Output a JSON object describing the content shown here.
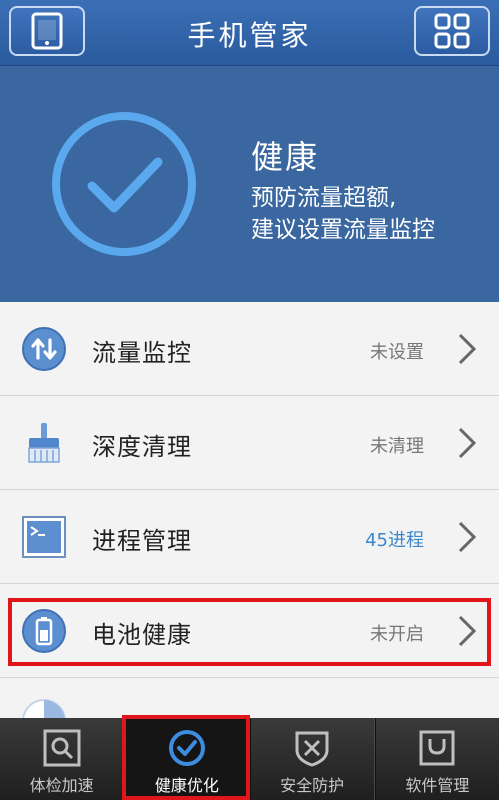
{
  "header": {
    "title": "手机管家"
  },
  "hero": {
    "status_title": "健康",
    "line1": "预防流量超额,",
    "line2": "建议设置流量监控"
  },
  "list": [
    {
      "label": "流量监控",
      "status": "未设置",
      "icon": "traffic-arrows-icon"
    },
    {
      "label": "深度清理",
      "status": "未清理",
      "icon": "brush-icon"
    },
    {
      "label": "进程管理",
      "status": "45进程",
      "icon": "terminal-icon"
    },
    {
      "label": "电池健康",
      "status": "未开启",
      "icon": "battery-icon"
    }
  ],
  "tabs": [
    {
      "label": "体检加速",
      "icon": "magnifier-icon"
    },
    {
      "label": "健康优化",
      "icon": "check-circle-icon"
    },
    {
      "label": "安全防护",
      "icon": "shield-icon"
    },
    {
      "label": "软件管理",
      "icon": "bag-icon"
    }
  ],
  "colors": {
    "header_blue": "#2b5a9e",
    "hero_blue": "#3a679f",
    "accent_blue": "#3b88cc",
    "highlight_red": "#e0161b"
  }
}
